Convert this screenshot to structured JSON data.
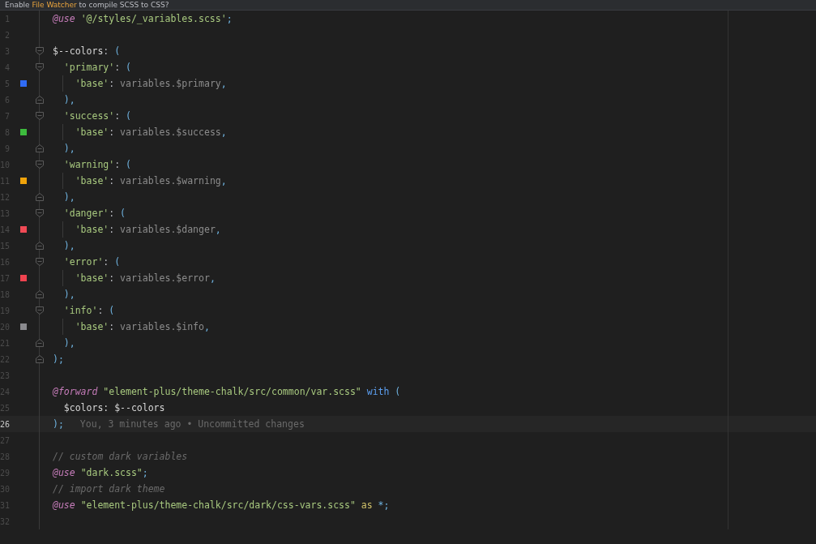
{
  "banner": {
    "parts": [
      {
        "kind": "plain",
        "text": "Enable "
      },
      {
        "kind": "link",
        "text": "File Watcher"
      },
      {
        "kind": "plain",
        "text": " to compile SCSS to CSS?"
      }
    ]
  },
  "lines": [
    {
      "number": "1",
      "fold_open": false,
      "fold_close": false,
      "guide": false,
      "current": false,
      "tokens": [
        {
          "kind": "kw",
          "t": "@use "
        },
        {
          "kind": "str",
          "t": "'@/styles/_variables.scss'"
        },
        {
          "kind": "p",
          "t": ";"
        }
      ]
    },
    {
      "number": "2",
      "fold_open": false,
      "fold_close": false,
      "guide": false,
      "current": false
    },
    {
      "number": "3",
      "fold_open": true,
      "fold_close": false,
      "guide": false,
      "current": false,
      "tokens": [
        {
          "kind": "id",
          "t": "$--colors"
        },
        {
          "kind": "o",
          "t": ": "
        },
        {
          "kind": "p",
          "t": "("
        }
      ]
    },
    {
      "number": "4",
      "fold_open": true,
      "fold_close": false,
      "guide": false,
      "current": false,
      "tokens": [
        {
          "kind": "str",
          "t": "  'primary'"
        },
        {
          "kind": "o",
          "t": ": "
        },
        {
          "kind": "p",
          "t": "("
        }
      ]
    },
    {
      "number": "5",
      "fold_open": false,
      "fold_close": false,
      "guide": true,
      "current": false,
      "color": "#2f6bf5",
      "tokens": [
        {
          "kind": "str",
          "t": "    'base'"
        },
        {
          "kind": "o",
          "t": ": "
        },
        {
          "kind": "v",
          "t": "variables.$primary"
        },
        {
          "kind": "p",
          "t": ","
        }
      ]
    },
    {
      "number": "6",
      "fold_open": false,
      "fold_close": true,
      "guide": false,
      "current": false,
      "tokens": [
        {
          "kind": "p",
          "t": "  ),"
        }
      ]
    },
    {
      "number": "7",
      "fold_open": true,
      "fold_close": false,
      "guide": false,
      "current": false,
      "tokens": [
        {
          "kind": "str",
          "t": "  'success'"
        },
        {
          "kind": "o",
          "t": ": "
        },
        {
          "kind": "p",
          "t": "("
        }
      ]
    },
    {
      "number": "8",
      "fold_open": false,
      "fold_close": false,
      "guide": true,
      "current": false,
      "color": "#3dbb3d",
      "tokens": [
        {
          "kind": "str",
          "t": "    'base'"
        },
        {
          "kind": "o",
          "t": ": "
        },
        {
          "kind": "v",
          "t": "variables.$success"
        },
        {
          "kind": "p",
          "t": ","
        }
      ]
    },
    {
      "number": "9",
      "fold_open": false,
      "fold_close": true,
      "guide": false,
      "current": false,
      "tokens": [
        {
          "kind": "p",
          "t": "  ),"
        }
      ]
    },
    {
      "number": "10",
      "fold_open": true,
      "fold_close": false,
      "guide": false,
      "current": false,
      "tokens": [
        {
          "kind": "str",
          "t": "  'warning'"
        },
        {
          "kind": "o",
          "t": ": "
        },
        {
          "kind": "p",
          "t": "("
        }
      ]
    },
    {
      "number": "11",
      "fold_open": false,
      "fold_close": false,
      "guide": true,
      "current": false,
      "color": "#f0a30a",
      "tokens": [
        {
          "kind": "str",
          "t": "    'base'"
        },
        {
          "kind": "o",
          "t": ": "
        },
        {
          "kind": "v",
          "t": "variables.$warning"
        },
        {
          "kind": "p",
          "t": ","
        }
      ]
    },
    {
      "number": "12",
      "fold_open": false,
      "fold_close": true,
      "guide": false,
      "current": false,
      "tokens": [
        {
          "kind": "p",
          "t": "  ),"
        }
      ]
    },
    {
      "number": "13",
      "fold_open": true,
      "fold_close": false,
      "guide": false,
      "current": false,
      "tokens": [
        {
          "kind": "str",
          "t": "  'danger'"
        },
        {
          "kind": "o",
          "t": ": "
        },
        {
          "kind": "p",
          "t": "("
        }
      ]
    },
    {
      "number": "14",
      "fold_open": false,
      "fold_close": false,
      "guide": true,
      "current": false,
      "color": "#f04a55",
      "tokens": [
        {
          "kind": "str",
          "t": "    'base'"
        },
        {
          "kind": "o",
          "t": ": "
        },
        {
          "kind": "v",
          "t": "variables.$danger"
        },
        {
          "kind": "p",
          "t": ","
        }
      ]
    },
    {
      "number": "15",
      "fold_open": false,
      "fold_close": true,
      "guide": false,
      "current": false,
      "tokens": [
        {
          "kind": "p",
          "t": "  ),"
        }
      ]
    },
    {
      "number": "16",
      "fold_open": true,
      "fold_close": false,
      "guide": false,
      "current": false,
      "tokens": [
        {
          "kind": "str",
          "t": "  'error'"
        },
        {
          "kind": "o",
          "t": ": "
        },
        {
          "kind": "p",
          "t": "("
        }
      ]
    },
    {
      "number": "17",
      "fold_open": false,
      "fold_close": false,
      "guide": true,
      "current": false,
      "color": "#f0434f",
      "tokens": [
        {
          "kind": "str",
          "t": "    'base'"
        },
        {
          "kind": "o",
          "t": ": "
        },
        {
          "kind": "v",
          "t": "variables.$error"
        },
        {
          "kind": "p",
          "t": ","
        }
      ]
    },
    {
      "number": "18",
      "fold_open": false,
      "fold_close": true,
      "guide": false,
      "current": false,
      "tokens": [
        {
          "kind": "p",
          "t": "  ),"
        }
      ]
    },
    {
      "number": "19",
      "fold_open": true,
      "fold_close": false,
      "guide": false,
      "current": false,
      "tokens": [
        {
          "kind": "str",
          "t": "  'info'"
        },
        {
          "kind": "o",
          "t": ": "
        },
        {
          "kind": "p",
          "t": "("
        }
      ]
    },
    {
      "number": "20",
      "fold_open": false,
      "fold_close": false,
      "guide": true,
      "current": false,
      "color": "#8a8a8e",
      "tokens": [
        {
          "kind": "str",
          "t": "    'base'"
        },
        {
          "kind": "o",
          "t": ": "
        },
        {
          "kind": "v",
          "t": "variables.$info"
        },
        {
          "kind": "p",
          "t": ","
        }
      ]
    },
    {
      "number": "21",
      "fold_open": false,
      "fold_close": true,
      "guide": false,
      "current": false,
      "tokens": [
        {
          "kind": "p",
          "t": "  ),"
        }
      ]
    },
    {
      "number": "22",
      "fold_open": false,
      "fold_close": true,
      "guide": false,
      "current": false,
      "tokens": [
        {
          "kind": "p",
          "t": ");"
        }
      ]
    },
    {
      "number": "23",
      "fold_open": false,
      "fold_close": false,
      "guide": false,
      "current": false
    },
    {
      "number": "24",
      "fold_open": false,
      "fold_close": false,
      "guide": false,
      "current": false,
      "tokens": [
        {
          "kind": "kw",
          "t": "@forward "
        },
        {
          "kind": "str",
          "t": "\"element-plus/theme-chalk/src/common/var.scss\" "
        },
        {
          "kind": "w",
          "t": "with "
        },
        {
          "kind": "p",
          "t": "("
        }
      ]
    },
    {
      "number": "25",
      "fold_open": false,
      "fold_close": false,
      "guide": false,
      "current": false,
      "tokens": [
        {
          "kind": "id",
          "t": "  $colors: $--colors"
        }
      ]
    },
    {
      "number": "26",
      "fold_open": false,
      "fold_close": false,
      "guide": false,
      "current": true,
      "blame": "You, 3 minutes ago • Uncommitted changes",
      "tokens": [
        {
          "kind": "p",
          "t": ");"
        }
      ]
    },
    {
      "number": "27",
      "fold_open": false,
      "fold_close": false,
      "guide": false,
      "current": false
    },
    {
      "number": "28",
      "fold_open": false,
      "fold_close": false,
      "guide": false,
      "current": false,
      "tokens": [
        {
          "kind": "c",
          "t": "// custom dark variables"
        }
      ]
    },
    {
      "number": "29",
      "fold_open": false,
      "fold_close": false,
      "guide": false,
      "current": false,
      "tokens": [
        {
          "kind": "kw",
          "t": "@use "
        },
        {
          "kind": "str",
          "t": "\"dark.scss\""
        },
        {
          "kind": "p",
          "t": ";"
        }
      ]
    },
    {
      "number": "30",
      "fold_open": false,
      "fold_close": false,
      "guide": false,
      "current": false,
      "tokens": [
        {
          "kind": "c",
          "t": "// import dark theme"
        }
      ]
    },
    {
      "number": "31",
      "fold_open": false,
      "fold_close": false,
      "guide": false,
      "current": false,
      "tokens": [
        {
          "kind": "kw",
          "t": "@use "
        },
        {
          "kind": "str",
          "t": "\"element-plus/theme-chalk/src/dark/css-vars.scss\" "
        },
        {
          "kind": "a",
          "t": "as "
        },
        {
          "kind": "p",
          "t": "*;"
        }
      ]
    },
    {
      "number": "32",
      "fold_open": false,
      "fold_close": false,
      "guide": false,
      "current": false
    }
  ]
}
